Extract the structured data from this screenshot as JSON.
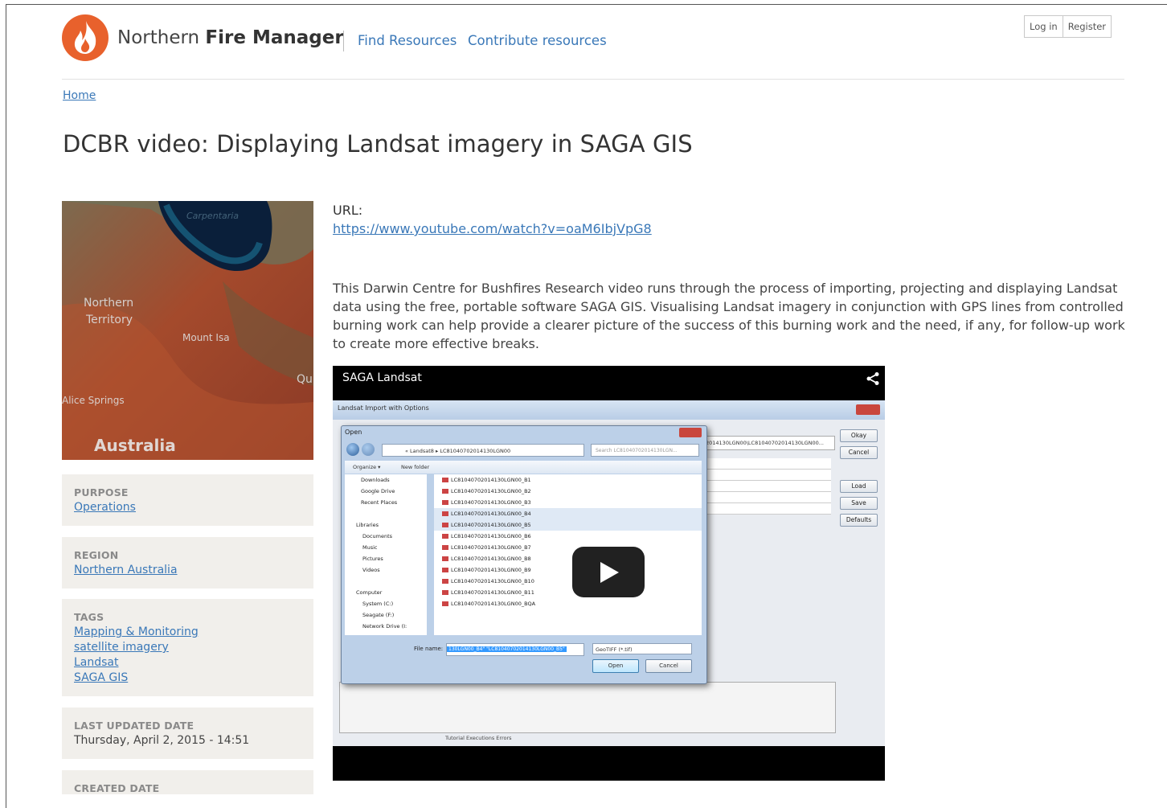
{
  "header": {
    "site_name_light": "Northern ",
    "site_name_bold": "Fire Manager",
    "nav": [
      "Find Resources",
      "Contribute resources"
    ],
    "login": "Log in",
    "register": "Register"
  },
  "breadcrumb": "Home",
  "page_title": "DCBR video: Displaying Landsat imagery in SAGA GIS",
  "map": {
    "labels": [
      "Carpentaria",
      "Northern",
      "Territory",
      "Mount Isa",
      "Qu",
      "Alice Springs",
      "Australia"
    ]
  },
  "sidebar": {
    "purpose": {
      "label": "PURPOSE",
      "value": "Operations"
    },
    "region": {
      "label": "REGION",
      "value": "Northern Australia"
    },
    "tags": {
      "label": "TAGS",
      "items": [
        "Mapping & Monitoring",
        "satellite imagery",
        "Landsat",
        "SAGA GIS"
      ]
    },
    "updated": {
      "label": "LAST UPDATED DATE",
      "value": "Thursday, April 2, 2015 - 14:51"
    },
    "created": {
      "label": "CREATED DATE"
    }
  },
  "content": {
    "url_label": "URL:",
    "url": "https://www.youtube.com/watch?v=oaM6IbjVpG8",
    "description": "This Darwin Centre for Bushfires Research video runs through the process of importing, projecting and displaying Landsat data using the free, portable software SAGA GIS. Visualising Landsat imagery in conjunction with GPS lines from controlled burning work can help provide a clearer picture of the success of this burning work and the need, if any, for follow-up work to create more effective breaks."
  },
  "video": {
    "title": "SAGA Landsat",
    "window_title": "Landsat Import with Options",
    "path_value": "2014130LGN00\\LC81040702014130LGN00...",
    "right_buttons": [
      "Okay",
      "Cancel",
      "Load",
      "Save",
      "Defaults"
    ],
    "dialog": {
      "title": "Open",
      "address": "« Landsat8 ▸ LC81040702014130LGN00",
      "search_placeholder": "Search LC81040702014130LGN...",
      "organize": "Organize ▾",
      "new_folder": "New folder",
      "tree": [
        "Downloads",
        "Google Drive",
        "Recent Places",
        "",
        "Libraries",
        "Documents",
        "Music",
        "Pictures",
        "Videos",
        "",
        "Computer",
        "System (C:)",
        "Seagate (F:)",
        "Network Drive (I:"
      ],
      "files": [
        "LC81040702014130LGN00_B1",
        "LC81040702014130LGN00_B2",
        "LC81040702014130LGN00_B3",
        "LC81040702014130LGN00_B4",
        "LC81040702014130LGN00_B5",
        "LC81040702014130LGN00_B6",
        "LC81040702014130LGN00_B7",
        "LC81040702014130LGN00_B8",
        "LC81040702014130LGN00_B9",
        "LC81040702014130LGN00_B10",
        "LC81040702014130LGN00_B11",
        "LC81040702014130LGN00_BQA"
      ],
      "file_name_label": "File name:",
      "file_name_value": "130LGN00_B4\" \"LC81040702014130LGN00_B5\"",
      "file_type": "GeoTIFF (*.tif)",
      "open": "Open",
      "cancel": "Cancel"
    },
    "tabs": "Tutorial   Executions   Errors"
  },
  "colors": {
    "accent": "#e8612c",
    "link": "#3a78b8",
    "box_bg": "#f1efeb"
  }
}
